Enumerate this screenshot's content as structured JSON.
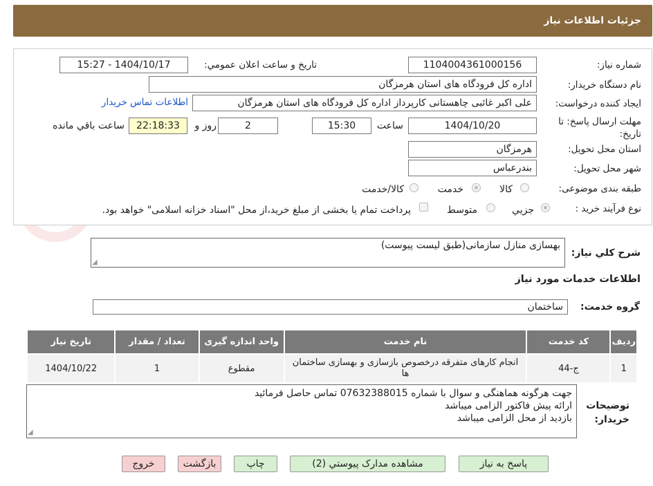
{
  "header": {
    "title": "جزئیات اطلاعات نیاز"
  },
  "form": {
    "need_number_label": "شماره نیاز:",
    "need_number": "1104004361000156",
    "announce_label": "تاریخ و ساعت اعلان عمومي:",
    "announce_value": "1404/10/17 - 15:27",
    "buyer_org_label": "نام دستگاه خریدار:",
    "buyer_org": "اداره کل فرودگاه های استان هرمزگان",
    "requester_label": "ایجاد کننده درخواست:",
    "requester": "علی اکبر غائبی چاهستانی کارپرداز اداره کل فرودگاه های استان هرمزگان",
    "contact_link": "اطلاعات تماس خریدار",
    "deadline_label": "مهلت ارسال پاسخ: تا تاریخ:",
    "deadline_date": "1404/10/20",
    "time_label": "ساعت",
    "deadline_time": "15:30",
    "days_value": "2",
    "days_label": "روز و",
    "remaining_time": "22:18:33",
    "remaining_label": "ساعت باقي مانده",
    "province_label": "استان محل تحویل:",
    "province": "هرمزگان",
    "city_label": "شهر محل تحویل:",
    "city": "بندرعباس",
    "category_label": "طبقه بندی موضوعی:",
    "category_options": [
      "کالا",
      "خدمت",
      "کالا/خدمت"
    ],
    "category_selected": "خدمت",
    "process_label": "نوع فرآیند خرید :",
    "process_options": [
      "جزيي",
      "متوسط"
    ],
    "process_selected": "جزيي",
    "payment_note": "پرداخت تمام یا بخشی از مبلغ خرید،از محل \"اسناد خزانه اسلامی\" خواهد بود."
  },
  "description": {
    "label": "شرح كلي نياز:",
    "value": "بهسازی منازل سازمانی(طبق لیست پیوست)"
  },
  "services": {
    "section_title": "اطلاعات خدمات مورد نیاز",
    "group_label": "گروه خدمت:",
    "group_value": "ساختمان",
    "columns": [
      "ردیف",
      "کد خدمت",
      "نام خدمت",
      "واحد اندازه گیری",
      "تعداد / مقدار",
      "تاریخ نیاز"
    ],
    "rows": [
      {
        "index": "1",
        "code": "ج-44",
        "name": "انجام کارهای متفرقه درخصوص بازسازی و بهسازی ساختمان ها",
        "unit": "مقطوع",
        "qty": "1",
        "date": "1404/10/22"
      }
    ]
  },
  "buyer_notes": {
    "label": "توضیحات خریدار:",
    "lines": [
      "جهت هرگونه هماهنگی و سوال با شماره 07632388015 تماس حاصل فرمائید",
      "ارائه پیش فاکتور الزامی میباشد",
      "بازدید از محل الزامی میباشد"
    ]
  },
  "buttons": {
    "reply": "پاسخ به نیاز",
    "attachments": "مشاهده مدارک پیوستي (2)",
    "print": "چاپ",
    "back": "بازگشت",
    "exit": "خروج"
  },
  "colors": {
    "header_bg": "#8a6a3f",
    "green_button": "#d7f0d2",
    "red_button": "#f6d0d0",
    "table_header": "#7a7a7a"
  }
}
